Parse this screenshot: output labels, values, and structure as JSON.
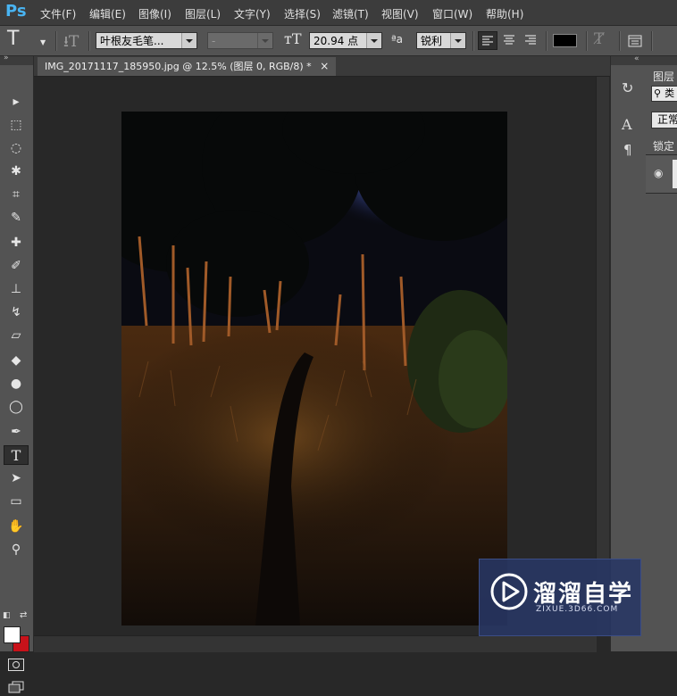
{
  "app": {
    "logo": "Ps",
    "menu": [
      "文件(F)",
      "编辑(E)",
      "图像(I)",
      "图层(L)",
      "文字(Y)",
      "选择(S)",
      "滤镜(T)",
      "视图(V)",
      "窗口(W)",
      "帮助(H)"
    ]
  },
  "options": {
    "tool_icon": "text-tool-icon",
    "font_family": "叶根友毛笔...",
    "font_style": "-",
    "font_size": "20.94 点",
    "aa_label": "ªa",
    "anti_alias": "锐利",
    "text_color": "#000000"
  },
  "toolbar": {
    "tools": [
      {
        "name": "move-tool",
        "glyph": "▸"
      },
      {
        "name": "marquee-tool",
        "glyph": "⬚"
      },
      {
        "name": "lasso-tool",
        "glyph": "◌"
      },
      {
        "name": "magic-wand-tool",
        "glyph": "✱"
      },
      {
        "name": "crop-tool",
        "glyph": "⌗"
      },
      {
        "name": "eyedropper-tool",
        "glyph": "✎"
      },
      {
        "name": "healing-brush-tool",
        "glyph": "✚"
      },
      {
        "name": "brush-tool",
        "glyph": "✐"
      },
      {
        "name": "clone-stamp-tool",
        "glyph": "⊥"
      },
      {
        "name": "history-brush-tool",
        "glyph": "↯"
      },
      {
        "name": "eraser-tool",
        "glyph": "▱"
      },
      {
        "name": "paint-bucket-tool",
        "glyph": "◆"
      },
      {
        "name": "blur-tool",
        "glyph": "●"
      },
      {
        "name": "dodge-tool",
        "glyph": "◯"
      },
      {
        "name": "pen-tool",
        "glyph": "✒"
      },
      {
        "name": "type-tool",
        "glyph": "T"
      },
      {
        "name": "path-selection-tool",
        "glyph": "➤"
      },
      {
        "name": "shape-tool",
        "glyph": "▭"
      },
      {
        "name": "hand-tool",
        "glyph": "✋"
      },
      {
        "name": "zoom-tool",
        "glyph": "⚲"
      }
    ],
    "foreground_color": "#ffffff",
    "background_color": "#c8121a"
  },
  "document": {
    "tab_title": "IMG_20171117_185950.jpg @ 12.5% (图层 0, RGB/8) *",
    "close_glyph": "×",
    "zoom": "12.5%"
  },
  "panels": {
    "layers_title": "图层",
    "search_partial": "类",
    "blend_mode": "正常",
    "lock_label": "锁定",
    "eye_glyph": "◉"
  },
  "watermark": {
    "title": "溜溜自学",
    "subtitle": "ZIXUE.3D66.COM"
  }
}
